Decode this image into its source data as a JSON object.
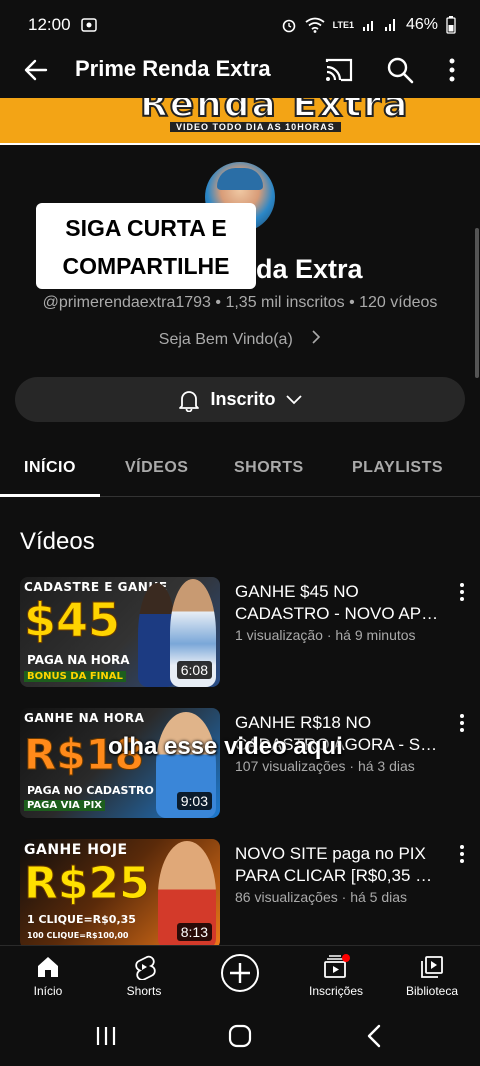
{
  "status_bar": {
    "time": "12:00",
    "network": "LTE1",
    "battery": "46%"
  },
  "app_bar": {
    "title": "Prime Renda Extra"
  },
  "banner": {
    "title": "Renda Extra",
    "subtitle": "VIDEO TODO DIA AS 10HORAS"
  },
  "overlay_box": {
    "line1": "SIGA CURTA E",
    "line2": "COMPARTILHE"
  },
  "channel": {
    "name_visible": "da Extra",
    "handle": "@primerendaextra1793",
    "subscribers": "1,35 mil inscritos",
    "video_count": "120 vídeos",
    "welcome": "Seja Bem Vindo(a)"
  },
  "subscribe": {
    "label": "Inscrito"
  },
  "tabs": [
    {
      "label": "INÍCIO",
      "active": true
    },
    {
      "label": "VÍDEOS",
      "active": false
    },
    {
      "label": "SHORTS",
      "active": false
    },
    {
      "label": "PLAYLISTS",
      "active": false
    }
  ],
  "section": {
    "title": "Vídeos"
  },
  "videos": [
    {
      "title": "GANHE $45 NO CADASTRO - NOVO AP…",
      "views": "1 visualização",
      "age": "há 9 minutos",
      "duration": "6:08",
      "thumb_top": "CADASTRE E GANHE",
      "thumb_big": "$45",
      "thumb_mid": "PAGA NA HORA",
      "thumb_bottom": "BONUS DA FINAL"
    },
    {
      "title": "GANHE R$18 NO CADASTRO AGORA - S…",
      "views": "107 visualizações",
      "age": "há 3 dias",
      "duration": "9:03",
      "thumb_top": "GANHE NA HORA",
      "thumb_big": "R$18",
      "thumb_mid": "PAGA NO CADASTRO",
      "thumb_bottom": "PAGA VIA PIX"
    },
    {
      "title": "NOVO SITE paga no PIX PARA CLICAR [R$0,35 …",
      "views": "86 visualizações",
      "age": "há 5 dias",
      "duration": "8:13",
      "thumb_top": "GANHE HOJE",
      "thumb_big": "R$25",
      "thumb_mid": "1 CLIQUE=R$0,35",
      "thumb_bottom": "100 CLIQUE=R$100,00"
    }
  ],
  "caption_overlay": "olha esse video aqui",
  "bottom_nav": [
    {
      "label": "Início",
      "icon": "home-icon"
    },
    {
      "label": "Shorts",
      "icon": "shorts-icon"
    },
    {
      "label": "",
      "icon": "create-icon"
    },
    {
      "label": "Inscrições",
      "icon": "subscriptions-icon"
    },
    {
      "label": "Biblioteca",
      "icon": "library-icon"
    }
  ]
}
